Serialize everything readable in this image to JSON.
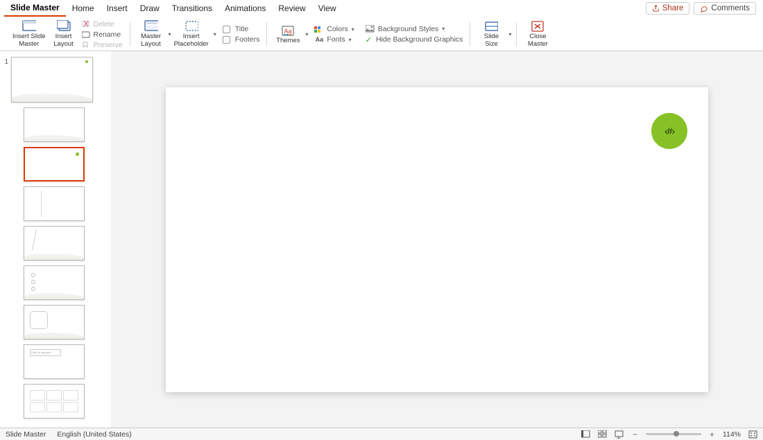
{
  "tabs": {
    "slide_master": "Slide Master",
    "home": "Home",
    "insert": "Insert",
    "draw": "Draw",
    "transitions": "Transitions",
    "animations": "Animations",
    "review": "Review",
    "view": "View"
  },
  "top_right": {
    "share": "Share",
    "comments": "Comments"
  },
  "ribbon": {
    "insert_slide_master": "Insert Slide\nMaster",
    "insert_layout": "Insert\nLayout",
    "delete": "Delete",
    "rename": "Rename",
    "preserve": "Preserve",
    "master_layout": "Master\nLayout",
    "insert_placeholder": "Insert\nPlaceholder",
    "title": "Title",
    "footers": "Footers",
    "themes": "Themes",
    "colors": "Colors",
    "fonts": "Fonts",
    "background_styles": "Background Styles",
    "hide_bg": "Hide Background Graphics",
    "slide_size": "Slide\nSize",
    "close_master": "Close\nMaster"
  },
  "slide_content": {
    "placeholder_number": "‹#›"
  },
  "thumbs": {
    "master_index": "1"
  },
  "status": {
    "mode": "Slide Master",
    "language": "English (United States)",
    "zoom": "114%"
  }
}
